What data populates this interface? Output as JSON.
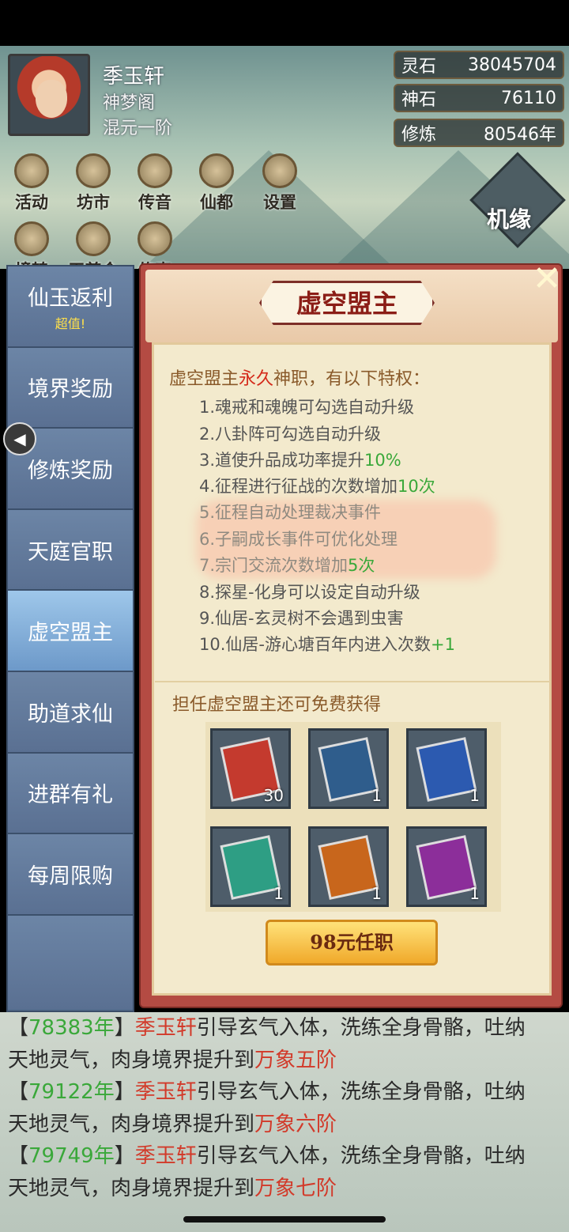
{
  "player": {
    "name": "季玉轩",
    "sect": "神梦阁",
    "rank": "混元一阶"
  },
  "stats": [
    {
      "label": "灵石",
      "value": "38045704"
    },
    {
      "label": "神石",
      "value": "76110"
    },
    {
      "label": "修炼",
      "value": "80546年"
    }
  ],
  "top_icons": [
    "活动",
    "坊市",
    "传音",
    "仙都",
    "设置"
  ],
  "top_icons_row2": [
    "境转",
    "天尊会",
    "修真"
  ],
  "jiyuan": "机缘",
  "sidebar": [
    {
      "label": "仙玉返利",
      "sub": "超值!"
    },
    {
      "label": "境界奖励"
    },
    {
      "label": "修炼奖励"
    },
    {
      "label": "天庭官职"
    },
    {
      "label": "虚空盟主"
    },
    {
      "label": "助道求仙"
    },
    {
      "label": "进群有礼"
    },
    {
      "label": "每周限购"
    }
  ],
  "panel": {
    "title": "虚空盟主",
    "intro_a": "虚空盟主",
    "intro_b": "永久",
    "intro_c": "神职，有以下特权：",
    "perks": [
      {
        "text": "1.魂戒和魂魄可勾选自动升级",
        "hl": ""
      },
      {
        "text": "2.八卦阵可勾选自动升级",
        "hl": ""
      },
      {
        "text": "3.道使升品成功率提升",
        "hl": "10%"
      },
      {
        "text": "4.征程进行征战的次数增加",
        "hl": "10次"
      },
      {
        "text": "5.征程自动处理裁决事件",
        "hl": ""
      },
      {
        "text": "6.子嗣成长事件可优化处理",
        "hl": ""
      },
      {
        "text": "7.宗门交流次数增加",
        "hl": "5次"
      },
      {
        "text": "8.探星-化身可以设定自动升级",
        "hl": ""
      },
      {
        "text": "9.仙居-玄灵树不会遇到虫害",
        "hl": ""
      },
      {
        "text": "10.仙居-游心塘百年内进入次数",
        "hl": "+1"
      }
    ],
    "free_label": "担任虚空盟主还可免费获得",
    "items": [
      {
        "icon": "scroll-icon",
        "count": "30",
        "color": "#c43a2e"
      },
      {
        "icon": "blue-book-icon",
        "count": "1",
        "color": "#2f5d8c"
      },
      {
        "icon": "blue-book-icon",
        "count": "1",
        "color": "#2c5ab0"
      },
      {
        "icon": "green-book-icon",
        "count": "1",
        "color": "#2e9e84"
      },
      {
        "icon": "orange-book-icon",
        "count": "1",
        "color": "#c8661c"
      },
      {
        "icon": "purple-book-icon",
        "count": "1",
        "color": "#8c2e9a"
      }
    ],
    "buy_label": "98元任职"
  },
  "log": [
    {
      "year": "78383年",
      "name": "季玉轩",
      "a": "引导玄气入体，洗练全身骨骼，吐纳",
      "b": "天地灵气，肉身境界提升到",
      "lv": "万象五阶"
    },
    {
      "year": "79122年",
      "name": "季玉轩",
      "a": "引导玄气入体，洗练全身骨骼，吐纳",
      "b": "天地灵气，肉身境界提升到",
      "lv": "万象六阶"
    },
    {
      "year": "79749年",
      "name": "季玉轩",
      "a": "引导玄气入体，洗练全身骨骼，吐纳",
      "b": "天地灵气，肉身境界提升到",
      "lv": "万象七阶"
    }
  ]
}
